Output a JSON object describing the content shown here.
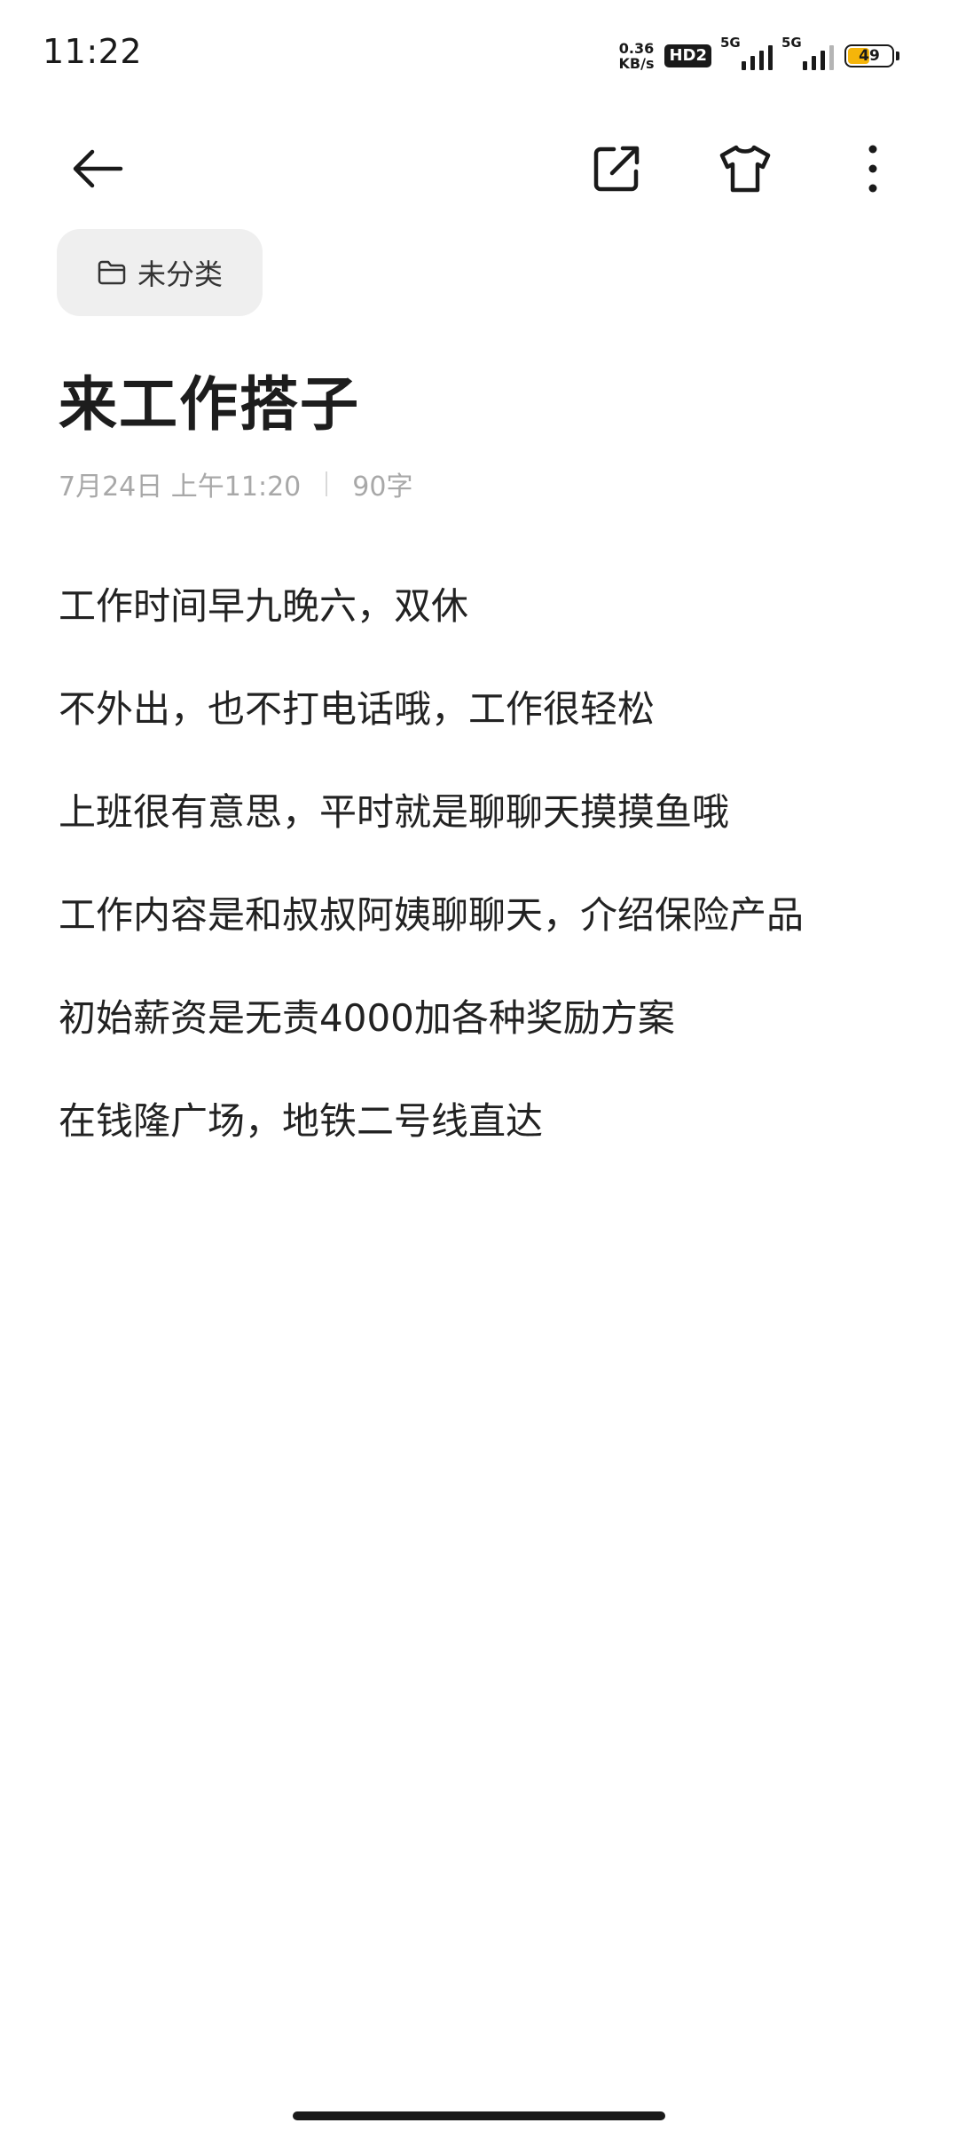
{
  "status_bar": {
    "time": "11:22",
    "net_speed_value": "0.36",
    "net_speed_unit": "KB/s",
    "hd_badge": "HD2",
    "signal1_label": "5G",
    "signal2_label": "5G",
    "battery_level": "49",
    "battery_fraction": 0.49,
    "battery_color": "#f5b50a"
  },
  "toolbar": {
    "back_icon": "arrow-left-icon",
    "share_icon": "share-external-icon",
    "theme_icon": "tshirt-icon",
    "more_icon": "more-vertical-icon"
  },
  "category": {
    "icon": "folder-icon",
    "label": "未分类"
  },
  "note": {
    "title": "来工作搭子",
    "date": "7月24日 上午11:20",
    "word_count": "90字",
    "lines": [
      "工作时间早九晚六，双休",
      "不外出，也不打电话哦，工作很轻松",
      "上班很有意思，平时就是聊聊天摸摸鱼哦",
      "工作内容是和叔叔阿姨聊聊天，介绍保险产品",
      "初始薪资是无责4000加各种奖励方案",
      "在钱隆广场，地铁二号线直达"
    ]
  }
}
